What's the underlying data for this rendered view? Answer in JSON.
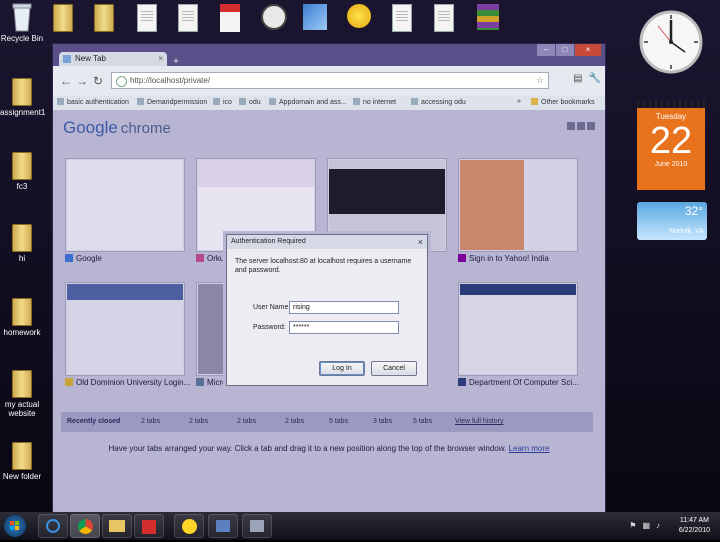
{
  "desktop": {
    "left_icons": [
      {
        "label": "Recycle Bin",
        "icon": "recycle-bin-icon"
      },
      {
        "label": "assignment1",
        "icon": "folder-icon"
      },
      {
        "label": "fc3",
        "icon": "folder-icon"
      },
      {
        "label": "hi",
        "icon": "folder-icon"
      },
      {
        "label": "homework",
        "icon": "folder-icon"
      },
      {
        "label": "my actual website",
        "icon": "folder-icon"
      },
      {
        "label": "New folder",
        "icon": "folder-icon"
      }
    ]
  },
  "browser": {
    "tab_title": "New Tab",
    "new_tab_glyph": "+",
    "address": "http://localhost/private/",
    "bookmarks": [
      "basic authentication",
      "Demandpermission",
      "ico",
      "odu",
      "Appdomain and ass...",
      "no internet",
      "accessing odu"
    ],
    "bookmarks_overflow": "»",
    "other_bookmarks": "Other bookmarks",
    "brand_google": "Google",
    "brand_chrome": "chrome",
    "thumbnails": [
      {
        "label": "Google"
      },
      {
        "label": "Orkut"
      },
      {
        "label": ""
      },
      {
        "label": "Sign in to Yahoo! India"
      },
      {
        "label": "Old Dominion University Login..."
      },
      {
        "label": "Micro..."
      },
      {
        "label": ""
      },
      {
        "label": "Department Of Computer Sci..."
      }
    ],
    "recently_closed": {
      "label": "Recently closed",
      "items": [
        "2 tabs",
        "2 tabs",
        "2 tabs",
        "2 tabs",
        "5 tabs",
        "3 tabs",
        "5 tabs"
      ],
      "view_full": "View full history"
    },
    "hint_text": "Have your tabs arranged your way. Click a tab and drag it to a new position along the top of the browser window.",
    "learn_more": "Learn more"
  },
  "dialog": {
    "title": "Authentication Required",
    "message": "The server localhost:80 at localhost requires a username and password.",
    "username_label": "User Name:",
    "username_value": "rising",
    "password_label": "Password:",
    "password_value": "******",
    "login_button": "Log In",
    "cancel_button": "Cancel"
  },
  "gadgets": {
    "calendar": {
      "weekday": "Tuesday",
      "day": "22",
      "month_year": "June 2010"
    },
    "weather": {
      "temp": "32°",
      "location": "Norfolk, VA"
    }
  },
  "taskbar": {
    "time": "11:47 AM",
    "date": "6/22/2010"
  },
  "colors": {
    "calendar_accent": "#e8731c",
    "browser_frame": "#5a4f88",
    "dialog_bg": "#ececf2"
  }
}
